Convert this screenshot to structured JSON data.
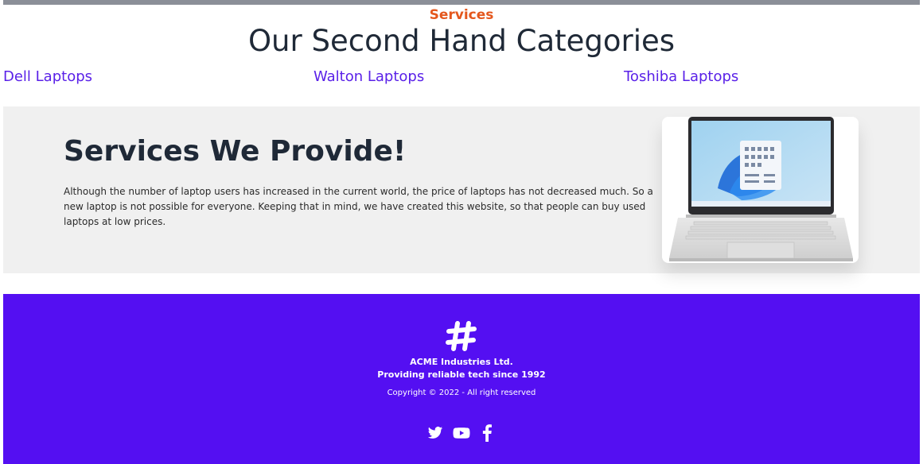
{
  "header": {
    "eyebrow": "Services",
    "title": "Our Second Hand Categories"
  },
  "categories": [
    {
      "label": "Dell Laptops"
    },
    {
      "label": "Walton Laptops"
    },
    {
      "label": "Toshiba Laptops"
    }
  ],
  "services": {
    "heading": "Services We Provide!",
    "description": "Although the number of laptop users has increased in the current world, the price of laptops has not decreased much. So a new laptop is not possible for everyone. Keeping that in mind, we have created this website, so that people can buy used laptops at low prices."
  },
  "footer": {
    "company": "ACME Industries Ltd.",
    "tagline": "Providing reliable tech since 1992",
    "copyright": "Copyright © 2022 - All right reserved",
    "social": [
      "twitter-icon",
      "youtube-icon",
      "facebook-icon"
    ]
  },
  "colors": {
    "accent_orange": "#e4571d",
    "link_purple": "#5a21e8",
    "footer_purple": "#540ff2",
    "panel_gray": "#f0f0f0"
  }
}
